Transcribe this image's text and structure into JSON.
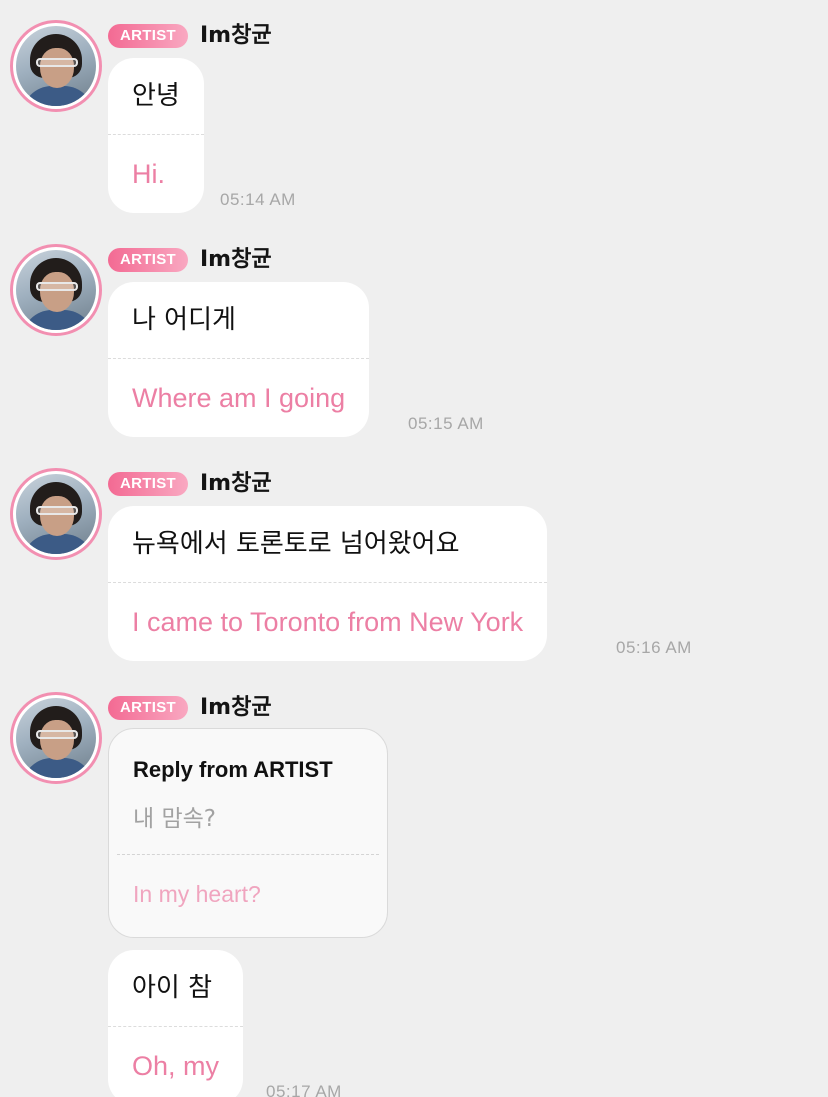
{
  "messages": [
    {
      "badge": "ARTIST",
      "name": "Im창균",
      "ko": "안녕",
      "en": "Hi.",
      "time": "05:14 AM"
    },
    {
      "badge": "ARTIST",
      "name": "Im창균",
      "ko": "나 어디게",
      "en": "Where am I going",
      "time": "05:15 AM"
    },
    {
      "badge": "ARTIST",
      "name": "Im창균",
      "ko": "뉴욕에서 토론토로 넘어왔어요",
      "en": "I came to Toronto from New York",
      "time": "05:16 AM"
    },
    {
      "badge": "ARTIST",
      "name": "Im창균",
      "reply": {
        "title": "Reply from ARTIST",
        "ko": "내 맘속?",
        "en": "In my heart?"
      },
      "ko": "아이 참",
      "en": "Oh, my",
      "time": "05:17 AM"
    }
  ],
  "colors": {
    "accent_pink": "#ec7fa4",
    "badge_start": "#f36a93",
    "badge_end": "#f9a8c1",
    "background": "#efefef"
  }
}
